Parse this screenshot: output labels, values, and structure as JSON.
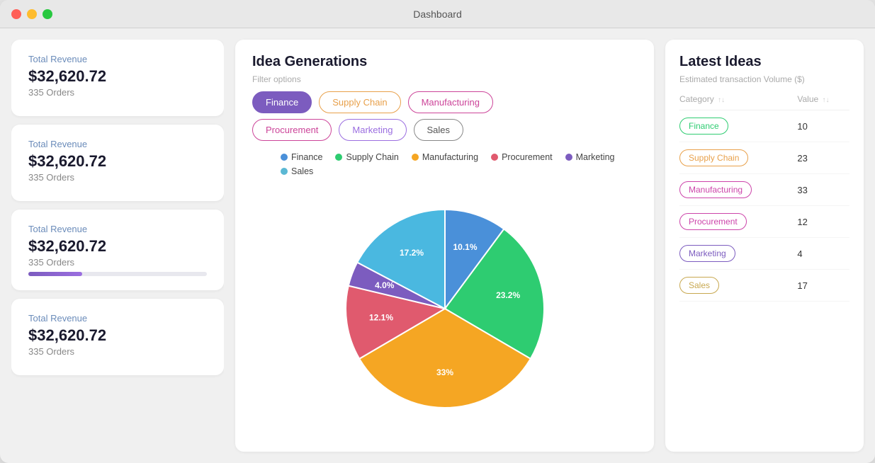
{
  "window": {
    "title": "Dashboard"
  },
  "sidebar": {
    "cards": [
      {
        "label": "Total Revenue",
        "value": "$32,620.72",
        "orders": "335 Orders",
        "hasProgress": false
      },
      {
        "label": "Total Revenue",
        "value": "$32,620.72",
        "orders": "335 Orders",
        "hasProgress": false
      },
      {
        "label": "Total Revenue",
        "value": "$32,620.72",
        "orders": "335 Orders",
        "hasProgress": true,
        "progressWidth": "30"
      },
      {
        "label": "Total Revenue",
        "value": "$32,620.72",
        "orders": "335 Orders",
        "hasProgress": false
      }
    ]
  },
  "main": {
    "title": "Idea Generations",
    "filterLabel": "Filter options",
    "filters": [
      {
        "label": "Finance",
        "active": true,
        "class": "active"
      },
      {
        "label": "Supply Chain",
        "active": false,
        "class": "supply-chain"
      },
      {
        "label": "Manufacturing",
        "active": false,
        "class": "manufacturing"
      },
      {
        "label": "Procurement",
        "active": false,
        "class": "procurement"
      },
      {
        "label": "Marketing",
        "active": false,
        "class": "marketing"
      },
      {
        "label": "Sales",
        "active": false,
        "class": "sales"
      }
    ],
    "legend": [
      {
        "label": "Finance",
        "color": "#4a90d9"
      },
      {
        "label": "Supply Chain",
        "color": "#2ecc71"
      },
      {
        "label": "Manufacturing",
        "color": "#f5a623"
      },
      {
        "label": "Procurement",
        "color": "#e05a6e"
      },
      {
        "label": "Marketing",
        "color": "#7c5cbf"
      },
      {
        "label": "Sales",
        "color": "#4a90d9"
      }
    ],
    "chart": {
      "segments": [
        {
          "label": "10.1%",
          "value": 10.1,
          "color": "#4a90d9"
        },
        {
          "label": "23.2%",
          "value": 23.2,
          "color": "#2ecc71"
        },
        {
          "label": "33%",
          "value": 33,
          "color": "#f5a623"
        },
        {
          "label": "12.1%",
          "value": 12.1,
          "color": "#e05a6e"
        },
        {
          "label": "4.0%",
          "value": 4.0,
          "color": "#7c5cbf"
        },
        {
          "label": "17.2%",
          "value": 17.2,
          "color": "#4ab8e0"
        }
      ]
    }
  },
  "right": {
    "title": "Latest Ideas",
    "subtitle": "Estimated transaction Volume ($)",
    "columns": [
      "Category",
      "Value"
    ],
    "rows": [
      {
        "category": "Finance",
        "badgeClass": "badge-finance",
        "value": "10"
      },
      {
        "category": "Supply Chain",
        "badgeClass": "badge-supply",
        "value": "23"
      },
      {
        "category": "Manufacturing",
        "badgeClass": "badge-manufacturing",
        "value": "33"
      },
      {
        "category": "Procurement",
        "badgeClass": "badge-procurement",
        "value": "12"
      },
      {
        "category": "Marketing",
        "badgeClass": "badge-marketing",
        "value": "4"
      },
      {
        "category": "Sales",
        "badgeClass": "badge-sales",
        "value": "17"
      }
    ]
  }
}
